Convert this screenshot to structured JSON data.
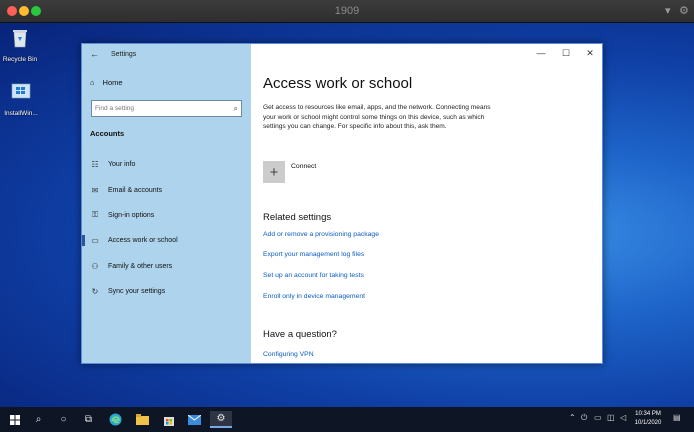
{
  "host": {
    "title": "1909"
  },
  "desktop": {
    "icons": [
      {
        "label": "Recycle Bin"
      },
      {
        "label": "InstallWin..."
      }
    ]
  },
  "window": {
    "app_title": "Settings",
    "controls": {
      "minimize": "—",
      "maximize": "☐",
      "close": "✕"
    }
  },
  "sidebar": {
    "home_label": "Home",
    "search_placeholder": "Find a setting",
    "section_title": "Accounts",
    "items": [
      {
        "label": "Your info",
        "icon": "person-card-icon"
      },
      {
        "label": "Email & accounts",
        "icon": "mail-icon"
      },
      {
        "label": "Sign-in options",
        "icon": "key-icon"
      },
      {
        "label": "Access work or school",
        "icon": "briefcase-icon",
        "selected": true
      },
      {
        "label": "Family & other users",
        "icon": "people-icon"
      },
      {
        "label": "Sync your settings",
        "icon": "sync-icon"
      }
    ]
  },
  "main": {
    "title": "Access work or school",
    "description": "Get access to resources like email, apps, and the network. Connecting means your work or school might control some things on this device, such as which settings you can change. For specific info about this, ask them.",
    "connect_label": "Connect",
    "related_title": "Related settings",
    "related_links": [
      "Add or remove a provisioning package",
      "Export your management log files",
      "Set up an account for taking tests",
      "Enroll only in device management"
    ],
    "question_title": "Have a question?",
    "question_links": [
      "Configuring VPN"
    ]
  },
  "taskbar": {
    "time": "10:34 PM",
    "date": "10/1/2020"
  }
}
